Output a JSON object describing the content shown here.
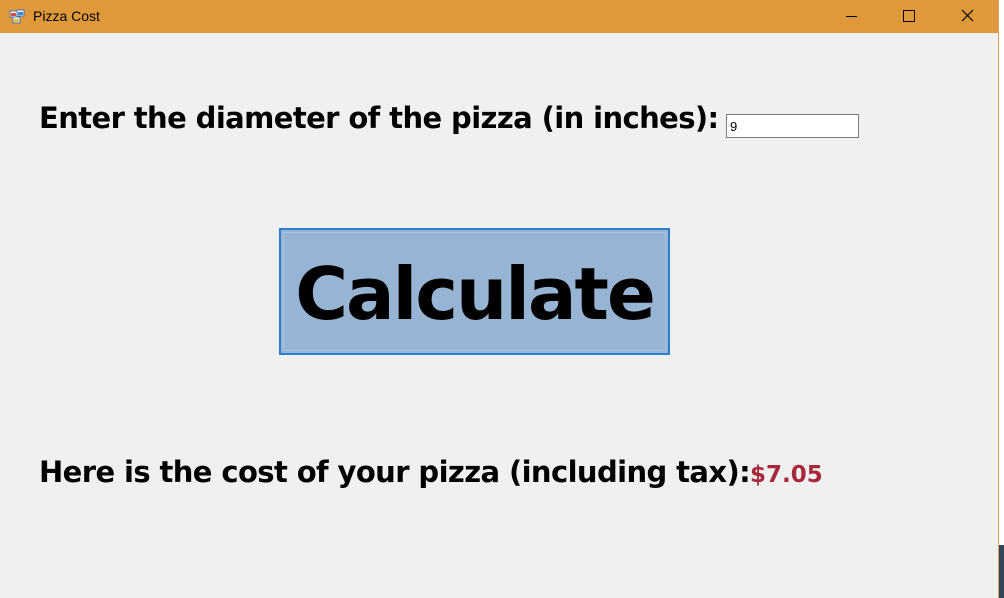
{
  "window": {
    "title": "Pizza Cost",
    "icon": "winforms-app-icon",
    "controls": [
      "minimize-icon",
      "maximize-icon",
      "close-icon"
    ],
    "titlebar_color": "#e0993a"
  },
  "form": {
    "diameter_label": "Enter the diameter of the pizza (in inches):",
    "diameter_value": "9",
    "calculate_label": "Calculate",
    "cost_label": "Here is the cost of your pizza (including tax):",
    "cost_value": "$7.05",
    "cost_color": "#a8283a"
  }
}
